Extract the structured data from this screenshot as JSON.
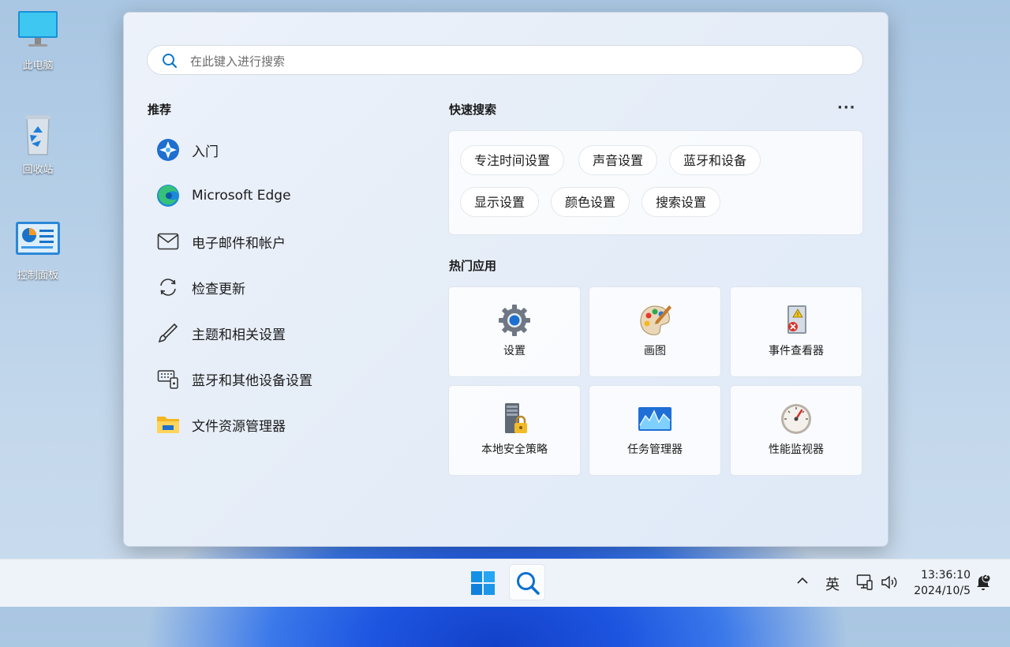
{
  "desktop": {
    "icons": [
      {
        "label": "此电脑",
        "icon": "computer-icon"
      },
      {
        "label": "回收站",
        "icon": "recycle-bin-icon"
      },
      {
        "label": "控制面板",
        "icon": "control-panel-icon"
      }
    ]
  },
  "search": {
    "placeholder": "在此键入进行搜索",
    "value": ""
  },
  "recommended": {
    "title": "推荐",
    "items": [
      {
        "label": "入门",
        "icon": "get-started-icon"
      },
      {
        "label": "Microsoft Edge",
        "icon": "edge-icon"
      },
      {
        "label": "电子邮件和帐户",
        "icon": "mail-icon"
      },
      {
        "label": "检查更新",
        "icon": "refresh-icon"
      },
      {
        "label": "主题和相关设置",
        "icon": "brush-icon"
      },
      {
        "label": "蓝牙和其他设备设置",
        "icon": "keyboard-device-icon"
      },
      {
        "label": "文件资源管理器",
        "icon": "folder-icon"
      }
    ]
  },
  "quick_search": {
    "title": "快速搜索",
    "more_label": "···",
    "chips": [
      "专注时间设置",
      "声音设置",
      "蓝牙和设备",
      "显示设置",
      "颜色设置",
      "搜索设置"
    ]
  },
  "top_apps": {
    "title": "热门应用",
    "apps": [
      {
        "label": "设置",
        "icon": "gear-icon"
      },
      {
        "label": "画图",
        "icon": "paint-palette-icon"
      },
      {
        "label": "事件查看器",
        "icon": "event-viewer-icon"
      },
      {
        "label": "本地安全策略",
        "icon": "security-policy-icon"
      },
      {
        "label": "任务管理器",
        "icon": "task-manager-icon"
      },
      {
        "label": "性能监视器",
        "icon": "performance-monitor-icon"
      }
    ]
  },
  "taskbar": {
    "ime_label": "英",
    "time": "13:36:10",
    "date": "2024/10/5",
    "notification_count": "2"
  },
  "colors": {
    "accent": "#0067c0",
    "panel_bg": "#e8eff9",
    "taskbar_bg": "#eef3f9"
  }
}
